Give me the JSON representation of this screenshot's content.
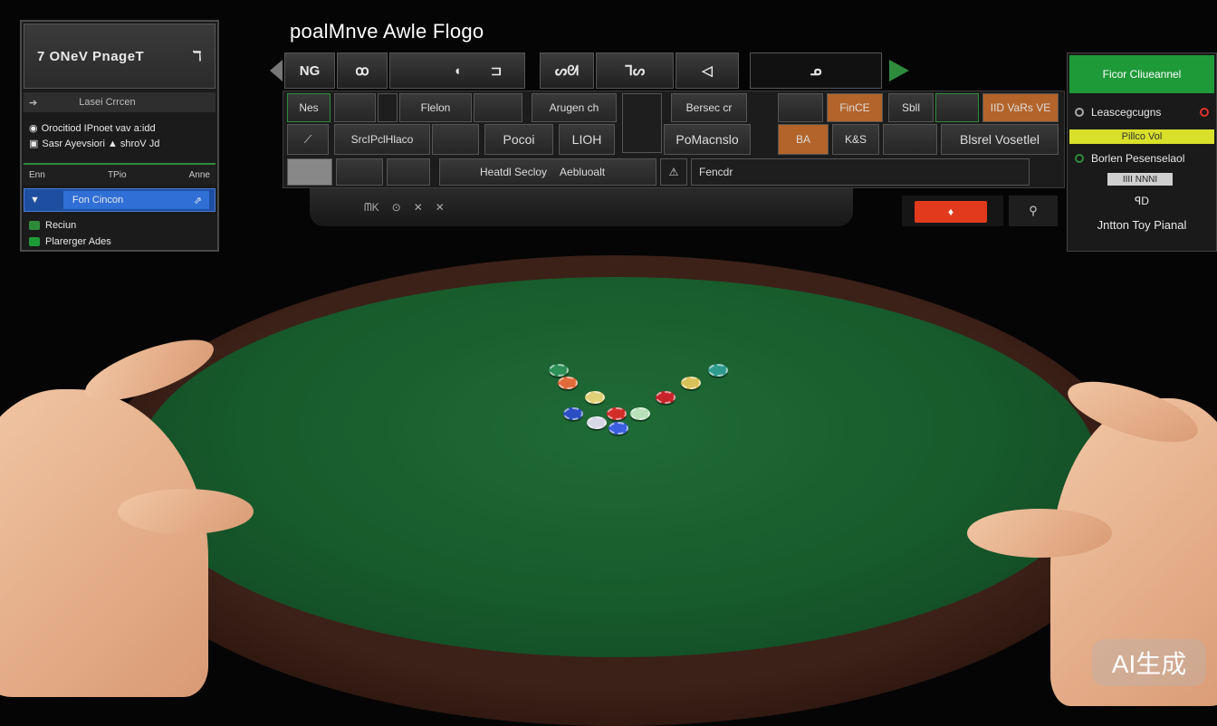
{
  "title": "poalMnve Awle Flogo",
  "left_panel": {
    "header": "7 ONeV PnageT",
    "header_arrow": "ℸ",
    "subtitle": "Lasei Crrcen",
    "info_line1": "Orocitiod IPnoet vav a:idd",
    "info_line2": "Sasr Ayevsiori ▲ shroV Jd",
    "tabs": [
      "Enn",
      "TPio",
      "Anne"
    ],
    "selected": "Fon Cincon",
    "options": [
      "Reciun",
      "Plarerger Ades"
    ]
  },
  "iconbar": {
    "labels": [
      "NG",
      "ꝏ",
      "◖",
      "⊐",
      "ᔕᘛ",
      "ᒣᔕ",
      "◁",
      "ᓄ"
    ]
  },
  "toolbar": {
    "row1": [
      "Nes",
      "Flelon",
      "Arugen ch",
      "Bersec cr",
      "FinCE",
      "Sbll",
      "IID VaRs VE"
    ],
    "row2": [
      "SrcIPclHlaco",
      "Pocoi",
      "LIOH",
      "PoMacnslo",
      "BA",
      "K&S",
      "Blsrel Vosetlel"
    ],
    "row3": [
      "Heatdl Secloy",
      "Aebluoalt",
      "Fencdr"
    ]
  },
  "subbar": [
    "ᗰK",
    "⊙",
    "✕",
    "✕"
  ],
  "red_button": "♦",
  "small_button": "⚲",
  "right_panel": {
    "header": "Ficor Cliueannel",
    "options": [
      "Leascegcugns",
      "Pillco Vol",
      "Borlen Pesenselaol",
      "IIII NNNI"
    ],
    "footer_icon": "ꟼD",
    "footer": "Jntton Toy Pianal"
  },
  "chips": [
    {
      "color": "#2e8f56"
    },
    {
      "color": "#e06a3a"
    },
    {
      "color": "#2f9b8e"
    },
    {
      "color": "#d9c15a"
    },
    {
      "color": "#c8232a"
    },
    {
      "color": "#e0d07a"
    },
    {
      "color": "#2a4fc2"
    },
    {
      "color": "#d7d7e6"
    },
    {
      "color": "#d32d2a"
    },
    {
      "color": "#b7e0b8"
    },
    {
      "color": "#3b5fe0"
    }
  ],
  "watermark": "AI生成"
}
